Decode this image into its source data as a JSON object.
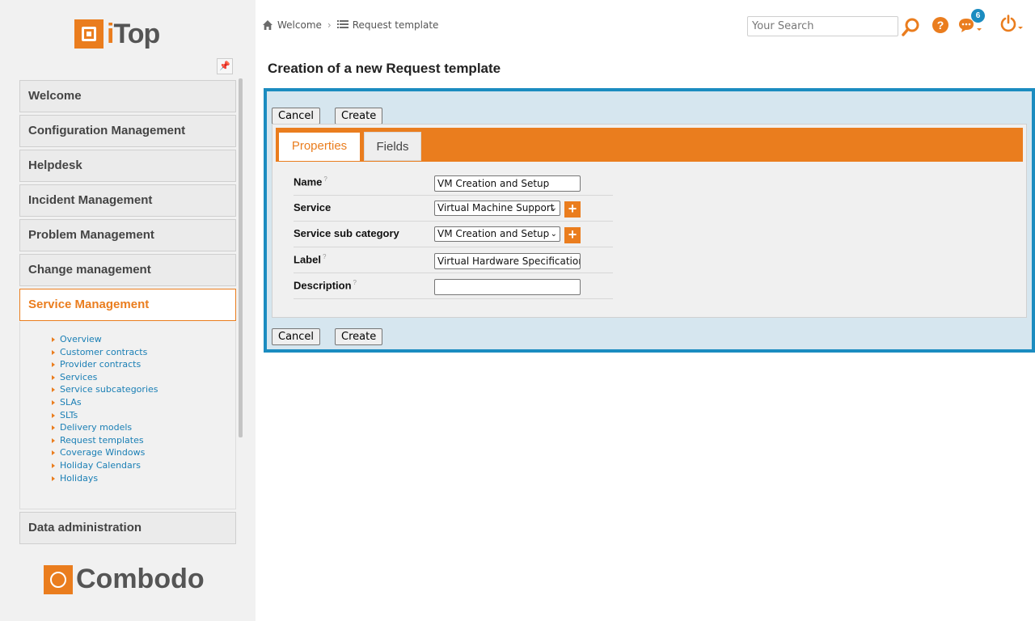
{
  "brand": {
    "logo_text": "iTop",
    "footer_logo_text": "Combodo"
  },
  "breadcrumb": {
    "home_label": "Welcome",
    "current_label": "Request template"
  },
  "header": {
    "search_placeholder": "Your Search",
    "notification_count": "6"
  },
  "sidebar": {
    "groups": [
      {
        "label": "Welcome"
      },
      {
        "label": "Configuration Management"
      },
      {
        "label": "Helpdesk"
      },
      {
        "label": "Incident Management"
      },
      {
        "label": "Problem Management"
      },
      {
        "label": "Change management"
      },
      {
        "label": "Service Management",
        "active": true
      },
      {
        "label": "Data administration"
      }
    ],
    "service_items": [
      "Overview",
      "Customer contracts",
      "Provider contracts",
      "Services",
      "Service subcategories",
      "SLAs",
      "SLTs",
      "Delivery models",
      "Request templates",
      "Coverage Windows",
      "Holiday Calendars",
      "Holidays"
    ]
  },
  "main": {
    "title": "Creation of a new Request template",
    "buttons": {
      "cancel": "Cancel",
      "create": "Create"
    },
    "tabs": [
      {
        "label": "Properties",
        "active": true
      },
      {
        "label": "Fields",
        "active": false
      }
    ],
    "fields": {
      "name": {
        "label": "Name",
        "value": "VM Creation and Setup"
      },
      "service": {
        "label": "Service",
        "value": "Virtual Machine Support"
      },
      "service_subcategory": {
        "label": "Service sub category",
        "value": "VM Creation and Setup"
      },
      "label": {
        "label": "Label",
        "value": "Virtual Hardware Specifications"
      },
      "description": {
        "label": "Description",
        "value": ""
      }
    },
    "help_mark": "?",
    "add_symbol": "+"
  },
  "colors": {
    "accent": "#ea7d1e",
    "frame": "#1b8cc0",
    "link": "#1a7fb5"
  }
}
